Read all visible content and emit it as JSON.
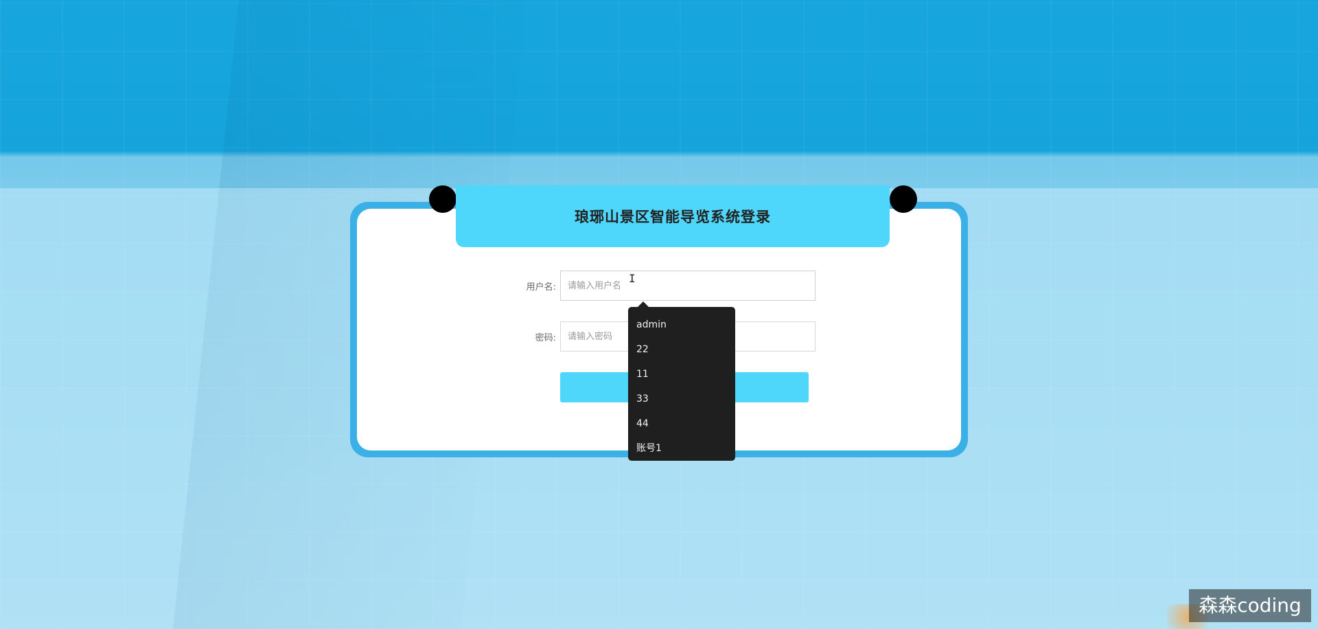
{
  "login": {
    "title": "琅琊山景区智能导览系统登录",
    "username_label": "用户名:",
    "username_placeholder": "请输入用户名",
    "password_label": "密码:",
    "password_placeholder": "请输入密码"
  },
  "autocomplete": {
    "items": [
      "admin",
      "22",
      "11",
      "33",
      "44",
      "账号1"
    ]
  },
  "watermark": "森森coding",
  "colors": {
    "accent": "#4fd6fb",
    "frame": "#3ab0e6",
    "dropdown_bg": "#1f1f1f"
  }
}
